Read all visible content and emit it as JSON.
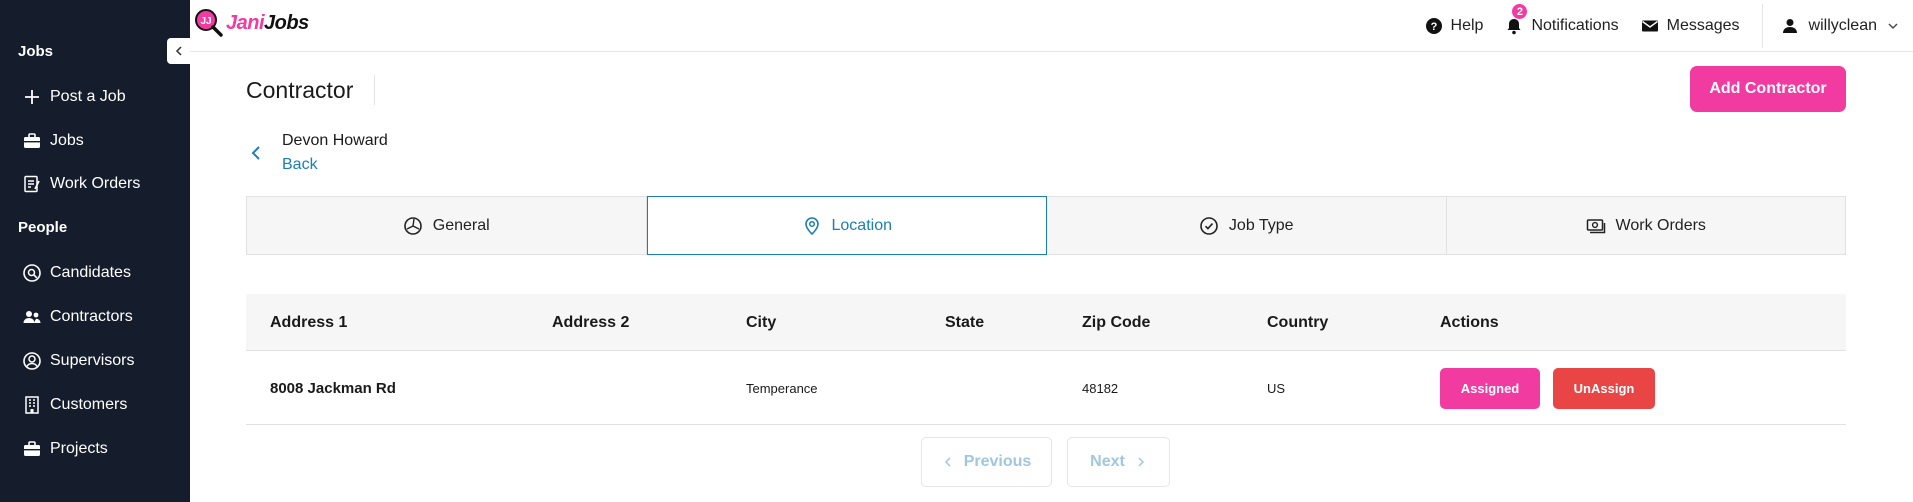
{
  "sidebar": {
    "sections": [
      {
        "label": "Jobs"
      },
      {
        "label": "People"
      }
    ],
    "jobs_items": [
      {
        "label": "Post a Job",
        "icon": "plus-icon"
      },
      {
        "label": "Jobs",
        "icon": "briefcase-icon"
      },
      {
        "label": "Work Orders",
        "icon": "work-order-icon"
      }
    ],
    "people_items": [
      {
        "label": "Candidates",
        "icon": "candidate-search-icon"
      },
      {
        "label": "Contractors",
        "icon": "people-icon"
      },
      {
        "label": "Supervisors",
        "icon": "user-circle-icon"
      },
      {
        "label": "Customers",
        "icon": "building-icon"
      },
      {
        "label": "Projects",
        "icon": "briefcase-icon"
      }
    ]
  },
  "header": {
    "logo_part1": "Jani",
    "logo_part2": "Jobs",
    "help_label": "Help",
    "notifications_label": "Notifications",
    "notifications_count": "2",
    "messages_label": "Messages",
    "username": "willyclean"
  },
  "page": {
    "title": "Contractor",
    "add_button_label": "Add Contractor",
    "person_name": "Devon Howard",
    "back_label": "Back"
  },
  "tabs": [
    {
      "label": "General",
      "icon": "palette-icon",
      "active": false
    },
    {
      "label": "Location",
      "icon": "map-pin-icon",
      "active": true
    },
    {
      "label": "Job Type",
      "icon": "check-circle-icon",
      "active": false
    },
    {
      "label": "Work Orders",
      "icon": "cash-icon",
      "active": false
    }
  ],
  "table": {
    "columns": [
      "Address 1",
      "Address 2",
      "City",
      "State",
      "Zip Code",
      "Country",
      "Actions"
    ],
    "rows": [
      {
        "address1": "8008 Jackman Rd",
        "address2": "",
        "city": "Temperance",
        "state": "",
        "zip": "48182",
        "country": "US",
        "assigned_label": "Assigned",
        "unassign_label": "UnAssign"
      }
    ]
  },
  "pagination": {
    "previous_label": "Previous",
    "next_label": "Next"
  },
  "colors": {
    "accent_pink": "#f23ba1",
    "link_blue": "#1b7eb4",
    "danger_red": "#ea4545",
    "sidebar_bg": "#151c2c"
  }
}
